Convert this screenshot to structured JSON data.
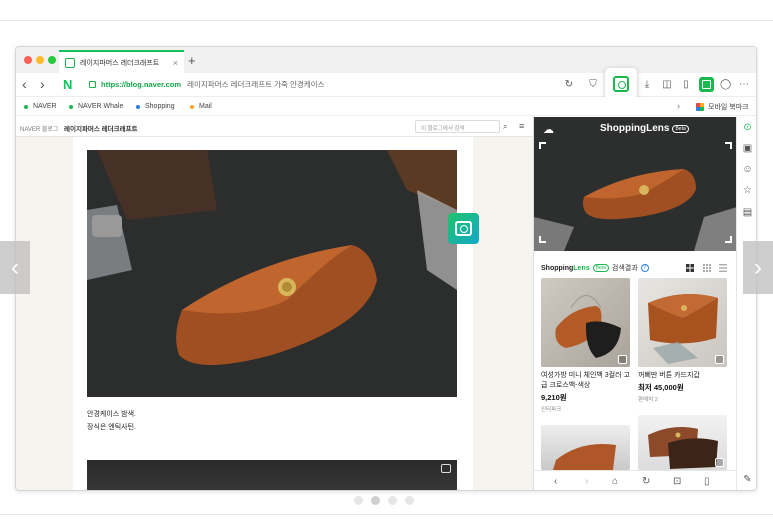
{
  "browser": {
    "tab_title": "레이지파머스 레더크래프트",
    "tab_close": "×",
    "new_tab": "+",
    "url_scheme_host": "https://blog.naver.com",
    "url_page_title": "레이지파머스 레더크래프트 가죽 안경케이스",
    "naver_logo": "N",
    "toolbar_icons": [
      "reload-icon",
      "shield-icon",
      "shopping-lens-icon",
      "download-icon",
      "screen-capture-icon",
      "reader-icon",
      "sidebar-icon",
      "profile-icon",
      "more-icon"
    ]
  },
  "bookmarks": {
    "items": [
      {
        "label": "NAVER",
        "color": "#19b94f"
      },
      {
        "label": "NAVER Whale",
        "color": "#19b94f"
      },
      {
        "label": "Shopping",
        "color": "#2f7de1"
      },
      {
        "label": "Mail",
        "color": "#f5a623"
      }
    ],
    "mobile_label": "모바일 북마크"
  },
  "blog": {
    "naver_blog_label": "NAVER 블로그",
    "blog_title": "레이지파머스 레더크래프트",
    "search_placeholder": "이 블로그에서 검색",
    "caption_line1": "안경케이스 밤색.",
    "caption_line2": "장식은 엔틱사틴."
  },
  "lens_panel": {
    "title": "ShoppingLens",
    "beta": "Beta",
    "results_brand_a": "Shopping",
    "results_brand_b": "Lens",
    "results_label": "검색결과",
    "help": "?",
    "products": [
      {
        "name": "여성가방 미니 체인백 3컬러 고급 크로스백-색상",
        "price": "9,210원",
        "seller": "인터파크"
      },
      {
        "name": "꺼삐딴 버튼 카드지갑",
        "price": "최저 45,000원",
        "seller": "판매처 2"
      }
    ]
  },
  "pager": {
    "count": 4,
    "active": 1
  }
}
